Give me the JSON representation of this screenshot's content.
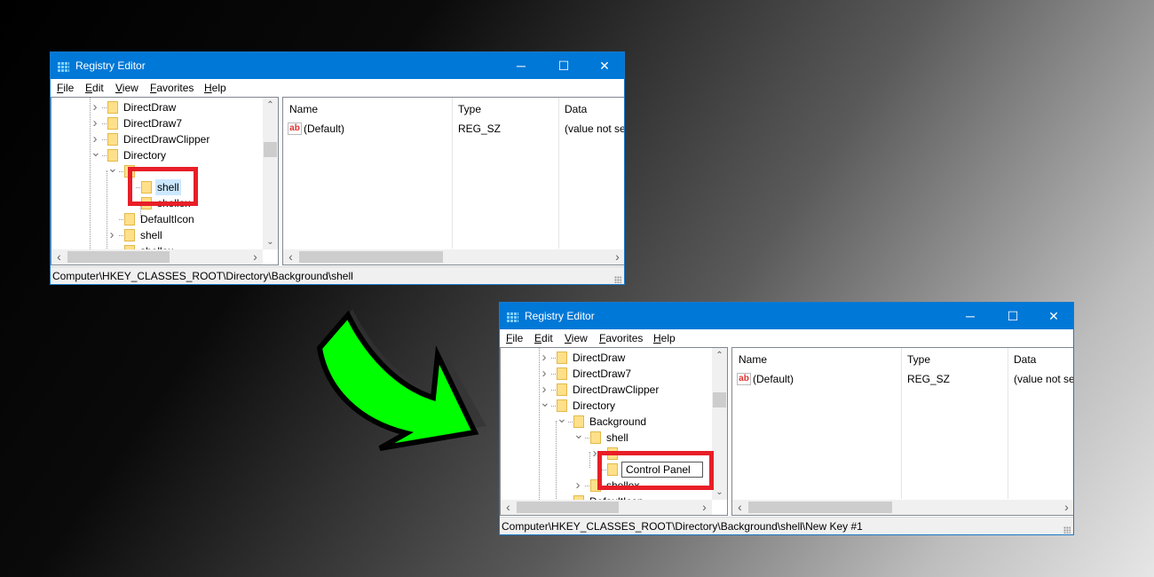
{
  "colors": {
    "titlebar": "#0078d7",
    "highlight_box": "#e81e27",
    "arrow": "#00ff00",
    "selection": "#cce8ff"
  },
  "windows": [
    {
      "title": "Registry Editor",
      "controls": {
        "minimize": "─",
        "maximize": "☐",
        "close": "✕"
      },
      "menu": [
        {
          "key": "F",
          "rest": "ile"
        },
        {
          "key": "E",
          "rest": "dit"
        },
        {
          "key": "V",
          "rest": "iew"
        },
        {
          "key": "F",
          "rest": "avorites",
          "pre": "",
          "alt": "Fa"
        },
        {
          "key": "H",
          "rest": "elp"
        }
      ],
      "tree": [
        {
          "label": "DirectDraw",
          "level": 1,
          "expander": "collapsed"
        },
        {
          "label": "DirectDraw7",
          "level": 1,
          "expander": "collapsed"
        },
        {
          "label": "DirectDrawClipper",
          "level": 1,
          "expander": "collapsed"
        },
        {
          "label": "Directory",
          "level": 1,
          "expander": "expanded"
        },
        {
          "label": "",
          "level": 2,
          "expander": "expanded"
        },
        {
          "label": "shell",
          "level": 3,
          "expander": "none",
          "selected": true
        },
        {
          "label": "shellex",
          "level": 3,
          "expander": "none"
        },
        {
          "label": "DefaultIcon",
          "level": 2,
          "expander": "none"
        },
        {
          "label": "shell",
          "level": 2,
          "expander": "collapsed"
        },
        {
          "label": "shellex",
          "level": 2,
          "expander": "none"
        }
      ],
      "columns": [
        "Name",
        "Type",
        "Data"
      ],
      "values": [
        {
          "name": "(Default)",
          "type": "REG_SZ",
          "data": "(value not set)",
          "icon": "string-value-icon",
          "icon_text": "ab"
        }
      ],
      "status": "Computer\\HKEY_CLASSES_ROOT\\Directory\\Background\\shell"
    },
    {
      "title": "Registry Editor",
      "controls": {
        "minimize": "─",
        "maximize": "☐",
        "close": "✕"
      },
      "menu": [
        {
          "key": "F",
          "rest": "ile"
        },
        {
          "key": "E",
          "rest": "dit"
        },
        {
          "key": "V",
          "rest": "iew"
        },
        {
          "key": "F",
          "rest": "avorites"
        },
        {
          "key": "H",
          "rest": "elp"
        }
      ],
      "tree": [
        {
          "label": "DirectDraw",
          "level": 1,
          "expander": "collapsed"
        },
        {
          "label": "DirectDraw7",
          "level": 1,
          "expander": "collapsed"
        },
        {
          "label": "DirectDrawClipper",
          "level": 1,
          "expander": "collapsed"
        },
        {
          "label": "Directory",
          "level": 1,
          "expander": "expanded"
        },
        {
          "label": "Background",
          "level": 2,
          "expander": "expanded"
        },
        {
          "label": "shell",
          "level": 3,
          "expander": "expanded"
        },
        {
          "label": "",
          "level": 4,
          "expander": "collapsed"
        },
        {
          "label": "Control Panel",
          "level": 4,
          "expander": "none",
          "editing": true
        },
        {
          "label": "shellex",
          "level": 3,
          "expander": "collapsed"
        },
        {
          "label": "DefaultIcon",
          "level": 2,
          "expander": "none"
        }
      ],
      "columns": [
        "Name",
        "Type",
        "Data"
      ],
      "values": [
        {
          "name": "(Default)",
          "type": "REG_SZ",
          "data": "(value not set)",
          "icon": "string-value-icon",
          "icon_text": "ab"
        }
      ],
      "status": "Computer\\HKEY_CLASSES_ROOT\\Directory\\Background\\shell\\New Key #1"
    }
  ]
}
